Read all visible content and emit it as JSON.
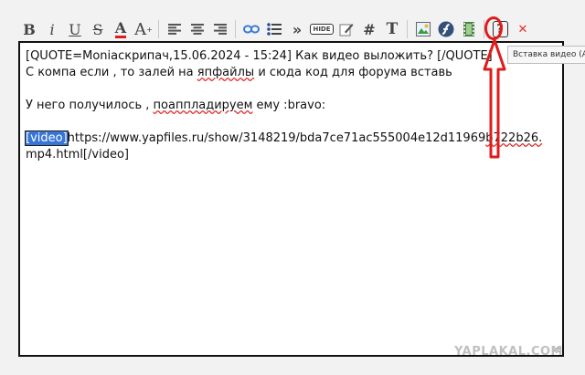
{
  "toolbar": {
    "bold": "B",
    "italic": "i",
    "underline": "U",
    "strike": "S",
    "font_color": "A",
    "font_size": "A",
    "quote": "»",
    "hide": "HIDE",
    "code": "#",
    "font_face": "T",
    "help": "?",
    "close": "✕"
  },
  "tooltip": "Вставка видео (Alt",
  "editor": {
    "line1": "[QUOTE=Moniaскрипач,15.06.2024 - 15:24] Как видео выложить? [/QUOTE]",
    "line2_a": "С компа если , то залей на ",
    "line2_b": "япфайлы",
    "line2_c": " и сюда код для форума вставь",
    "line3_a": "У него получилось , ",
    "line3_b": "поаппладируем",
    "line3_c": " ему  :bravo:",
    "tag_open": "[video]",
    "url_a": "https://www.yapfiles.ru/show/3148219/bda7ce71ac555004e12d11969",
    "url_b": "b722b26.",
    "url_line2": "mp4.html[/video]"
  },
  "watermark": "YAPLAKAL.COM",
  "colors": {
    "annotation": "#e01b1b",
    "selection": "#3875d7"
  }
}
